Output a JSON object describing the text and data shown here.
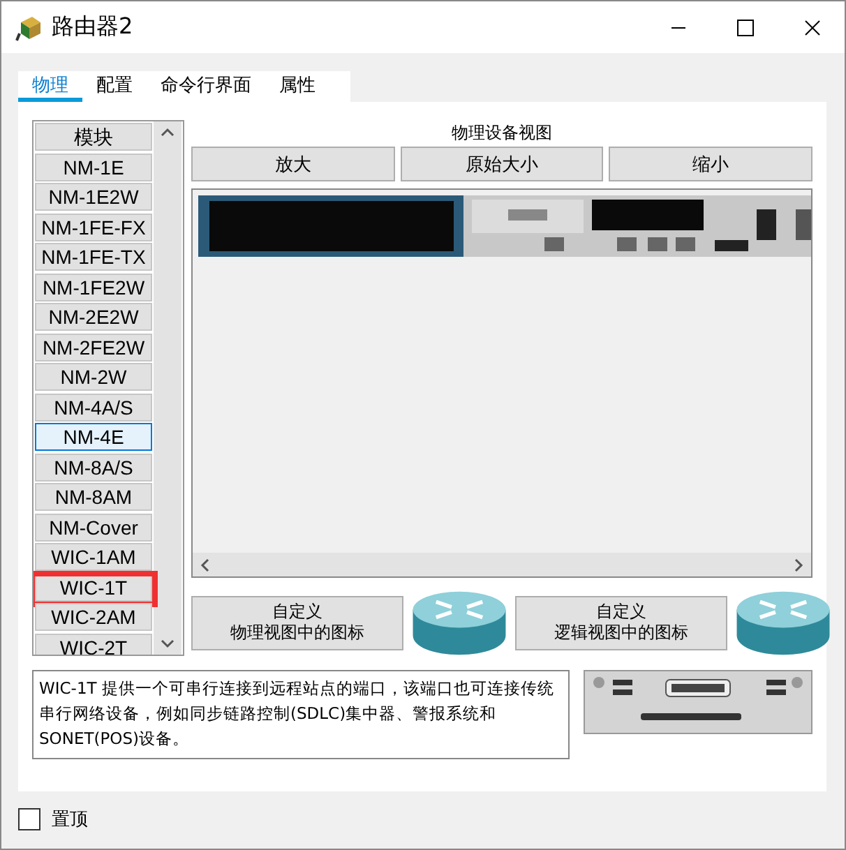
{
  "window": {
    "title": "路由器2"
  },
  "tabs": [
    {
      "label": "物理",
      "selected": true
    },
    {
      "label": "配置",
      "selected": false
    },
    {
      "label": "命令行界面",
      "selected": false
    },
    {
      "label": "属性",
      "selected": false
    }
  ],
  "modules": {
    "header": "模块",
    "items": [
      {
        "label": "NM-1E",
        "selected": false,
        "highlighted": false
      },
      {
        "label": "NM-1E2W",
        "selected": false,
        "highlighted": false
      },
      {
        "label": "NM-1FE-FX",
        "selected": false,
        "highlighted": false
      },
      {
        "label": "NM-1FE-TX",
        "selected": false,
        "highlighted": false
      },
      {
        "label": "NM-1FE2W",
        "selected": false,
        "highlighted": false
      },
      {
        "label": "NM-2E2W",
        "selected": false,
        "highlighted": false
      },
      {
        "label": "NM-2FE2W",
        "selected": false,
        "highlighted": false
      },
      {
        "label": "NM-2W",
        "selected": false,
        "highlighted": false
      },
      {
        "label": "NM-4A/S",
        "selected": false,
        "highlighted": false
      },
      {
        "label": "NM-4E",
        "selected": true,
        "highlighted": false
      },
      {
        "label": "NM-8A/S",
        "selected": false,
        "highlighted": false
      },
      {
        "label": "NM-8AM",
        "selected": false,
        "highlighted": false
      },
      {
        "label": "NM-Cover",
        "selected": false,
        "highlighted": false
      },
      {
        "label": "WIC-1AM",
        "selected": false,
        "highlighted": false
      },
      {
        "label": "WIC-1T",
        "selected": false,
        "highlighted": true
      },
      {
        "label": "WIC-2AM",
        "selected": false,
        "highlighted": false
      },
      {
        "label": "WIC-2T",
        "selected": false,
        "highlighted": false
      }
    ]
  },
  "device_view": {
    "title": "物理设备视图",
    "buttons": [
      "放大",
      "原始大小",
      "缩小"
    ]
  },
  "custom_buttons": [
    {
      "lines": [
        "自定义",
        "物理视图中的图标"
      ]
    },
    {
      "lines": [
        "自定义",
        "逻辑视图中的图标"
      ]
    }
  ],
  "description": "WIC-1T 提供一个可串行连接到远程站点的端口，该端口也可连接传统串行网络设备，例如同步链路控制(SDLC)集中器、警报系统和SONET(POS)设备。",
  "always_on_top": {
    "label": "置顶",
    "checked": false
  }
}
